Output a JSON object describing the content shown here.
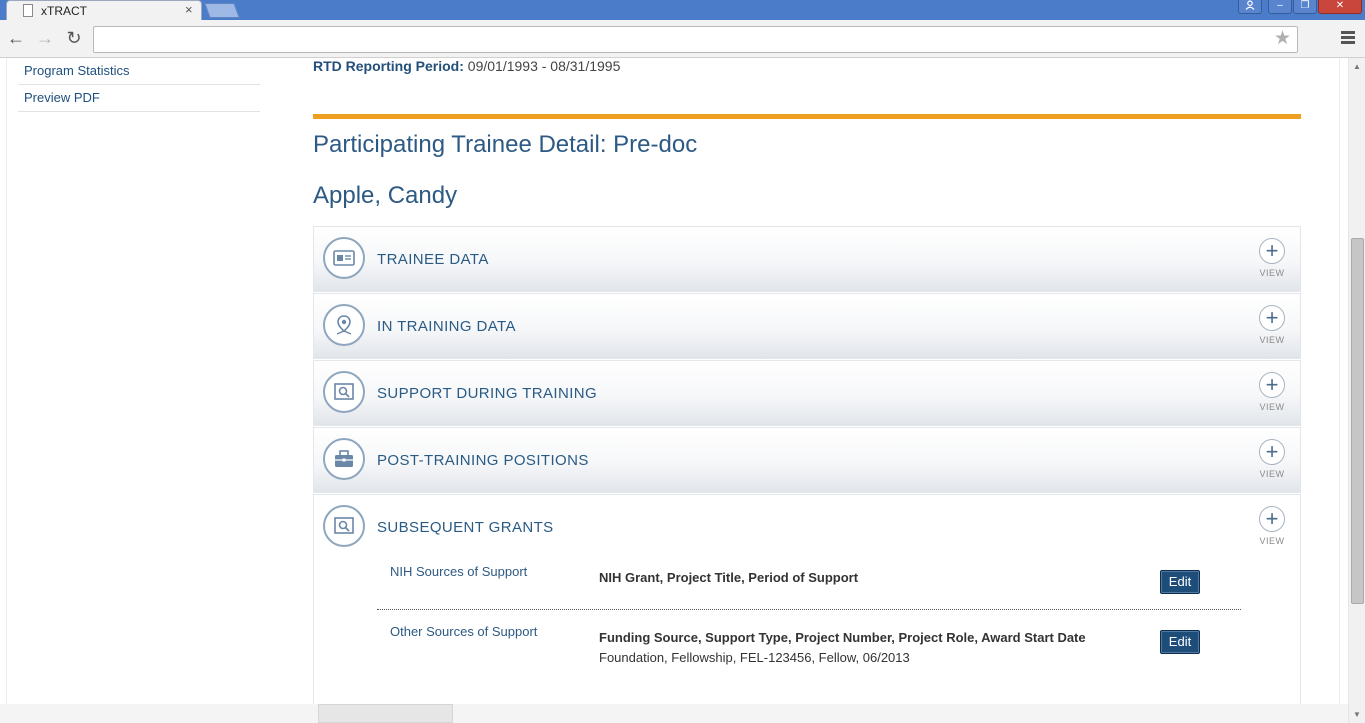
{
  "browser": {
    "tab_title": "xTRACT",
    "tab_close": "×",
    "back_glyph": "←",
    "forward_glyph": "→",
    "reload_glyph": "↻",
    "star_glyph": "★",
    "address": "",
    "win_min": "–",
    "win_max": "❐",
    "win_close": "✕",
    "win_user": "👤"
  },
  "sidebar": {
    "items": [
      {
        "label": "Program Statistics"
      },
      {
        "label": "Preview PDF"
      }
    ]
  },
  "header": {
    "period_label": "RTD Reporting Period:",
    "period_value": "09/01/1993 - 08/31/1995",
    "detail_title": "Participating Trainee Detail: Pre-doc",
    "trainee_name": "Apple, Candy"
  },
  "sections": [
    {
      "title": "TRAINEE DATA",
      "icon": "id-card-icon"
    },
    {
      "title": "IN TRAINING DATA",
      "icon": "map-pin-icon"
    },
    {
      "title": "SUPPORT DURING TRAINING",
      "icon": "search-doc-icon"
    },
    {
      "title": "POST-TRAINING POSITIONS",
      "icon": "briefcase-icon"
    },
    {
      "title": "SUBSEQUENT GRANTS",
      "icon": "search-doc-icon"
    }
  ],
  "view_label": "VIEW",
  "view_plus": "+",
  "subsequent_grants": {
    "nih": {
      "label": "NIH Sources of Support",
      "header": "NIH Grant, Project Title, Period of Support",
      "edit": "Edit"
    },
    "other": {
      "label": "Other Sources of Support",
      "header": "Funding Source, Support Type, Project Number, Project Role, Award Start Date",
      "value": "Foundation, Fellowship, FEL-123456, Fellow, 06/2013",
      "edit": "Edit"
    }
  },
  "colors": {
    "accent_orange": "#f0a020",
    "heading_blue": "#2d5a84",
    "button_navy": "#1f4d7a"
  }
}
